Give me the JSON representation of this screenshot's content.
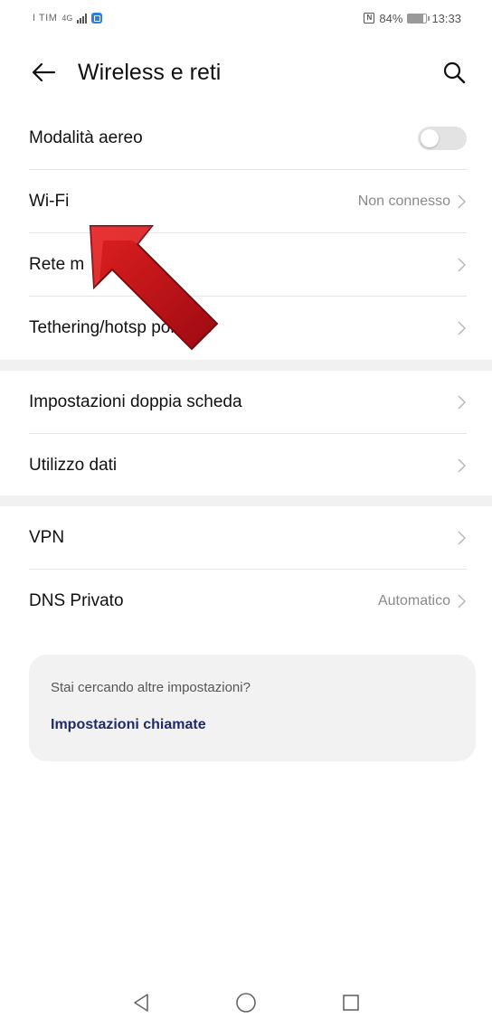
{
  "status_bar": {
    "carrier": "I TIM",
    "network_type": "4G",
    "battery": "84%",
    "time": "13:33"
  },
  "header": {
    "title": "Wireless e reti",
    "back_icon": "arrow-left-icon",
    "search_icon": "search-icon"
  },
  "group1": {
    "items": [
      {
        "label": "Modalità aereo",
        "toggle": "off"
      },
      {
        "label": "Wi-Fi",
        "value": "Non connesso"
      },
      {
        "label": "Rete m"
      },
      {
        "label": "Tethering/hotsp portatile"
      }
    ]
  },
  "group2": {
    "items": [
      {
        "label": "Impostazioni doppia scheda"
      },
      {
        "label": "Utilizzo dati"
      }
    ]
  },
  "group3": {
    "items": [
      {
        "label": "VPN"
      },
      {
        "label": "DNS Privato",
        "value": "Automatico"
      }
    ]
  },
  "suggestion": {
    "prompt": "Stai cercando altre impostazioni?",
    "link": "Impostazioni chiamate"
  },
  "colors": {
    "accent_link": "#1f2a6b",
    "arrow": "#c8101a",
    "divider_band": "#f1f1f1"
  },
  "nav": {
    "back": "triangle-back-icon",
    "home": "circle-home-icon",
    "recents": "square-recents-icon"
  }
}
